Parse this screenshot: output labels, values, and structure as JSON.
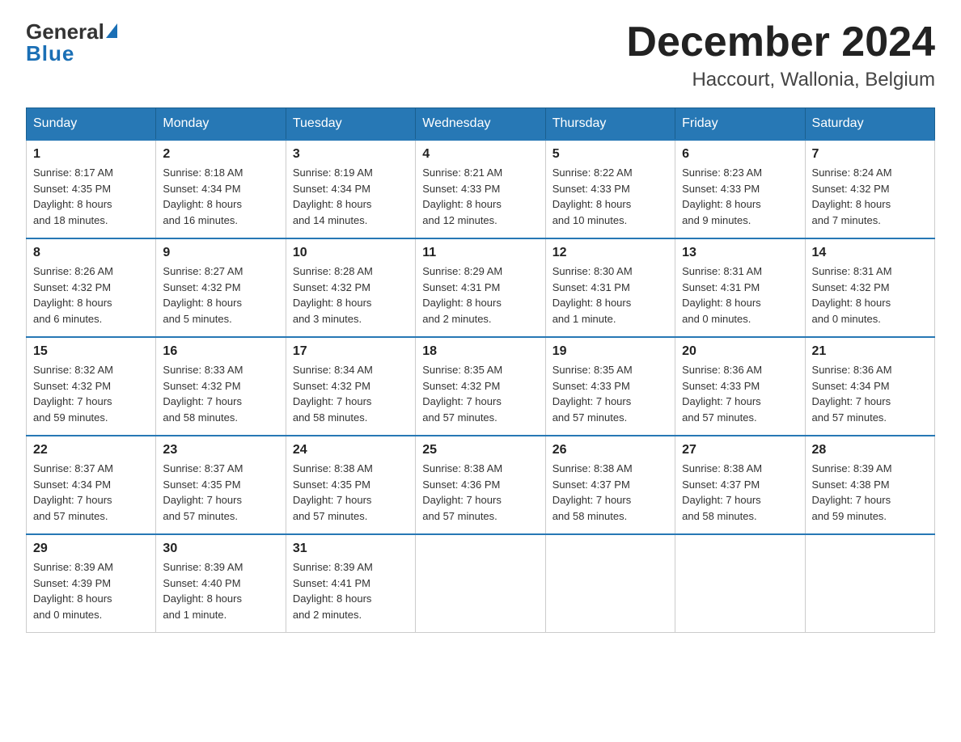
{
  "logo": {
    "general": "General",
    "blue": "Blue"
  },
  "header": {
    "month_year": "December 2024",
    "location": "Haccourt, Wallonia, Belgium"
  },
  "days_of_week": [
    "Sunday",
    "Monday",
    "Tuesday",
    "Wednesday",
    "Thursday",
    "Friday",
    "Saturday"
  ],
  "weeks": [
    [
      {
        "day": "1",
        "sunrise": "8:17 AM",
        "sunset": "4:35 PM",
        "daylight": "8 hours and 18 minutes."
      },
      {
        "day": "2",
        "sunrise": "8:18 AM",
        "sunset": "4:34 PM",
        "daylight": "8 hours and 16 minutes."
      },
      {
        "day": "3",
        "sunrise": "8:19 AM",
        "sunset": "4:34 PM",
        "daylight": "8 hours and 14 minutes."
      },
      {
        "day": "4",
        "sunrise": "8:21 AM",
        "sunset": "4:33 PM",
        "daylight": "8 hours and 12 minutes."
      },
      {
        "day": "5",
        "sunrise": "8:22 AM",
        "sunset": "4:33 PM",
        "daylight": "8 hours and 10 minutes."
      },
      {
        "day": "6",
        "sunrise": "8:23 AM",
        "sunset": "4:33 PM",
        "daylight": "8 hours and 9 minutes."
      },
      {
        "day": "7",
        "sunrise": "8:24 AM",
        "sunset": "4:32 PM",
        "daylight": "8 hours and 7 minutes."
      }
    ],
    [
      {
        "day": "8",
        "sunrise": "8:26 AM",
        "sunset": "4:32 PM",
        "daylight": "8 hours and 6 minutes."
      },
      {
        "day": "9",
        "sunrise": "8:27 AM",
        "sunset": "4:32 PM",
        "daylight": "8 hours and 5 minutes."
      },
      {
        "day": "10",
        "sunrise": "8:28 AM",
        "sunset": "4:32 PM",
        "daylight": "8 hours and 3 minutes."
      },
      {
        "day": "11",
        "sunrise": "8:29 AM",
        "sunset": "4:31 PM",
        "daylight": "8 hours and 2 minutes."
      },
      {
        "day": "12",
        "sunrise": "8:30 AM",
        "sunset": "4:31 PM",
        "daylight": "8 hours and 1 minute."
      },
      {
        "day": "13",
        "sunrise": "8:31 AM",
        "sunset": "4:31 PM",
        "daylight": "8 hours and 0 minutes."
      },
      {
        "day": "14",
        "sunrise": "8:31 AM",
        "sunset": "4:32 PM",
        "daylight": "8 hours and 0 minutes."
      }
    ],
    [
      {
        "day": "15",
        "sunrise": "8:32 AM",
        "sunset": "4:32 PM",
        "daylight": "7 hours and 59 minutes."
      },
      {
        "day": "16",
        "sunrise": "8:33 AM",
        "sunset": "4:32 PM",
        "daylight": "7 hours and 58 minutes."
      },
      {
        "day": "17",
        "sunrise": "8:34 AM",
        "sunset": "4:32 PM",
        "daylight": "7 hours and 58 minutes."
      },
      {
        "day": "18",
        "sunrise": "8:35 AM",
        "sunset": "4:32 PM",
        "daylight": "7 hours and 57 minutes."
      },
      {
        "day": "19",
        "sunrise": "8:35 AM",
        "sunset": "4:33 PM",
        "daylight": "7 hours and 57 minutes."
      },
      {
        "day": "20",
        "sunrise": "8:36 AM",
        "sunset": "4:33 PM",
        "daylight": "7 hours and 57 minutes."
      },
      {
        "day": "21",
        "sunrise": "8:36 AM",
        "sunset": "4:34 PM",
        "daylight": "7 hours and 57 minutes."
      }
    ],
    [
      {
        "day": "22",
        "sunrise": "8:37 AM",
        "sunset": "4:34 PM",
        "daylight": "7 hours and 57 minutes."
      },
      {
        "day": "23",
        "sunrise": "8:37 AM",
        "sunset": "4:35 PM",
        "daylight": "7 hours and 57 minutes."
      },
      {
        "day": "24",
        "sunrise": "8:38 AM",
        "sunset": "4:35 PM",
        "daylight": "7 hours and 57 minutes."
      },
      {
        "day": "25",
        "sunrise": "8:38 AM",
        "sunset": "4:36 PM",
        "daylight": "7 hours and 57 minutes."
      },
      {
        "day": "26",
        "sunrise": "8:38 AM",
        "sunset": "4:37 PM",
        "daylight": "7 hours and 58 minutes."
      },
      {
        "day": "27",
        "sunrise": "8:38 AM",
        "sunset": "4:37 PM",
        "daylight": "7 hours and 58 minutes."
      },
      {
        "day": "28",
        "sunrise": "8:39 AM",
        "sunset": "4:38 PM",
        "daylight": "7 hours and 59 minutes."
      }
    ],
    [
      {
        "day": "29",
        "sunrise": "8:39 AM",
        "sunset": "4:39 PM",
        "daylight": "8 hours and 0 minutes."
      },
      {
        "day": "30",
        "sunrise": "8:39 AM",
        "sunset": "4:40 PM",
        "daylight": "8 hours and 1 minute."
      },
      {
        "day": "31",
        "sunrise": "8:39 AM",
        "sunset": "4:41 PM",
        "daylight": "8 hours and 2 minutes."
      },
      null,
      null,
      null,
      null
    ]
  ],
  "labels": {
    "sunrise": "Sunrise:",
    "sunset": "Sunset:",
    "daylight": "Daylight:"
  }
}
